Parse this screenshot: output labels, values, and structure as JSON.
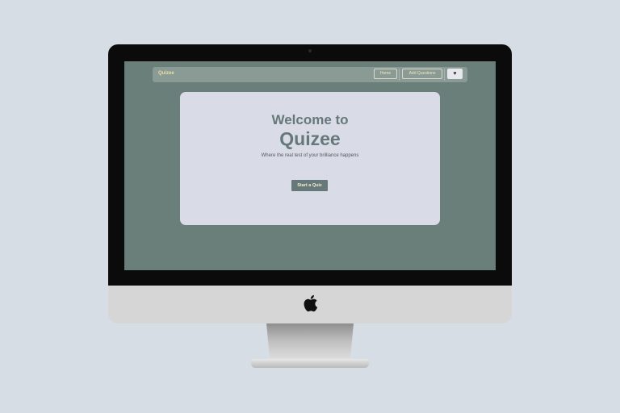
{
  "navbar": {
    "brand": "Quizee",
    "links": [
      {
        "label": "Home"
      },
      {
        "label": "Add Questions"
      }
    ],
    "heart_icon": "heart-icon"
  },
  "hero": {
    "welcome": "Welcome to",
    "title": "Quizee",
    "tagline": "Where the real test of your brilliance happens",
    "cta_label": "Start a Quiz"
  },
  "colors": {
    "page_background": "#d6dde5",
    "screen_background": "#6b7f7a",
    "navbar_background": "#8a9a95",
    "brand_text": "#e8dfa8",
    "card_background": "#d9dbe6",
    "accent": "#66787a"
  },
  "device": {
    "logo_icon": "apple-logo-icon"
  }
}
